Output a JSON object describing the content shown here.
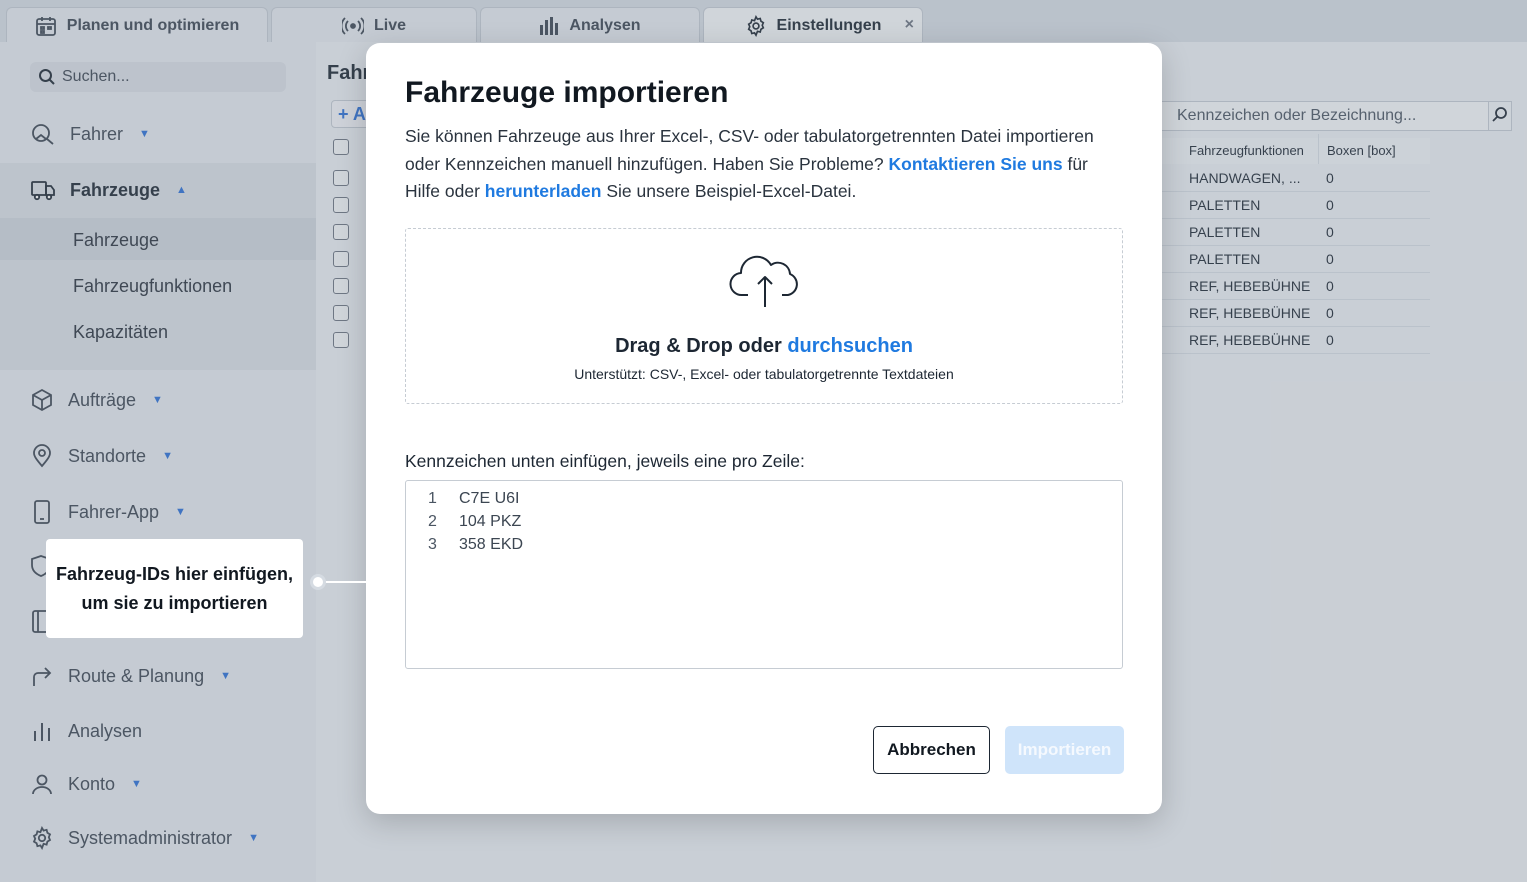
{
  "tabs": [
    {
      "label": "Planen und optimieren",
      "icon": "calendar-icon"
    },
    {
      "label": "Live",
      "icon": "broadcast-icon"
    },
    {
      "label": "Analysen",
      "icon": "bar-chart-icon"
    },
    {
      "label": "Einstellungen",
      "icon": "gear-icon",
      "active": true,
      "close": "×"
    }
  ],
  "sidebar": {
    "search_placeholder": "Suchen...",
    "items": [
      {
        "label": "Fahrer",
        "icon": "driver-icon"
      },
      {
        "label": "Fahrzeuge",
        "icon": "truck-icon",
        "expanded": true
      },
      {
        "label": "Aufträge",
        "icon": "box-icon"
      },
      {
        "label": "Standorte",
        "icon": "location-pin-icon"
      },
      {
        "label": "Fahrer-App",
        "icon": "phone-icon"
      },
      {
        "label": "Route & Planung",
        "icon": "route-arrow-icon"
      },
      {
        "label": "Analysen",
        "icon": "bar-chart-icon"
      },
      {
        "label": "Konto",
        "icon": "user-icon"
      },
      {
        "label": "Systemadministrator",
        "icon": "gear-icon"
      }
    ],
    "subitems": [
      "Fahrzeuge",
      "Fahrzeugfunktionen",
      "Kapazitäten"
    ]
  },
  "background": {
    "page_title_partial": "Fahr",
    "add_button_partial": "+ A",
    "search_placeholder": "Kennzeichen oder Bezeichnung...",
    "columns": [
      "Fahrzeugfunktionen",
      "Boxen [box]"
    ],
    "rows": [
      [
        "HANDWAGEN, ...",
        "0"
      ],
      [
        "PALETTEN",
        "0"
      ],
      [
        "PALETTEN",
        "0"
      ],
      [
        "PALETTEN",
        "0"
      ],
      [
        "REF, HEBEBÜHNE",
        "0"
      ],
      [
        "REF, HEBEBÜHNE",
        "0"
      ],
      [
        "REF, HEBEBÜHNE",
        "0"
      ]
    ]
  },
  "modal": {
    "title": "Fahrzeuge importieren",
    "desc_part1": "Sie können Fahrzeuge aus Ihrer Excel-, CSV- oder tabulatorgetrennten Datei importieren oder Kennzeichen manuell hinzufügen. Haben Sie Probleme? ",
    "desc_link1": "Kontaktieren Sie uns",
    "desc_part2": " für Hilfe oder ",
    "desc_link2": "herunterladen",
    "desc_part3": " Sie unsere Beispiel-Excel-Datei.",
    "drop_main": "Drag & Drop oder ",
    "drop_link": "durchsuchen",
    "drop_sub": "Unterstützt: CSV-, Excel- oder tabulatorgetrennte Textdateien",
    "paste_label": "Kennzeichen unten einfügen, jeweils eine pro Zeile:",
    "lines": [
      {
        "num": "1",
        "text": "C7E U6I"
      },
      {
        "num": "2",
        "text": "104 PKZ"
      },
      {
        "num": "3",
        "text": "358 EKD"
      }
    ],
    "cancel_label": "Abbrechen",
    "import_label": "Importieren"
  },
  "callout": {
    "text": "Fahrzeug-IDs hier einfügen, um sie zu importieren"
  },
  "colors": {
    "accent": "#1f7ae0",
    "import_disabled": "#cfe4fa"
  }
}
